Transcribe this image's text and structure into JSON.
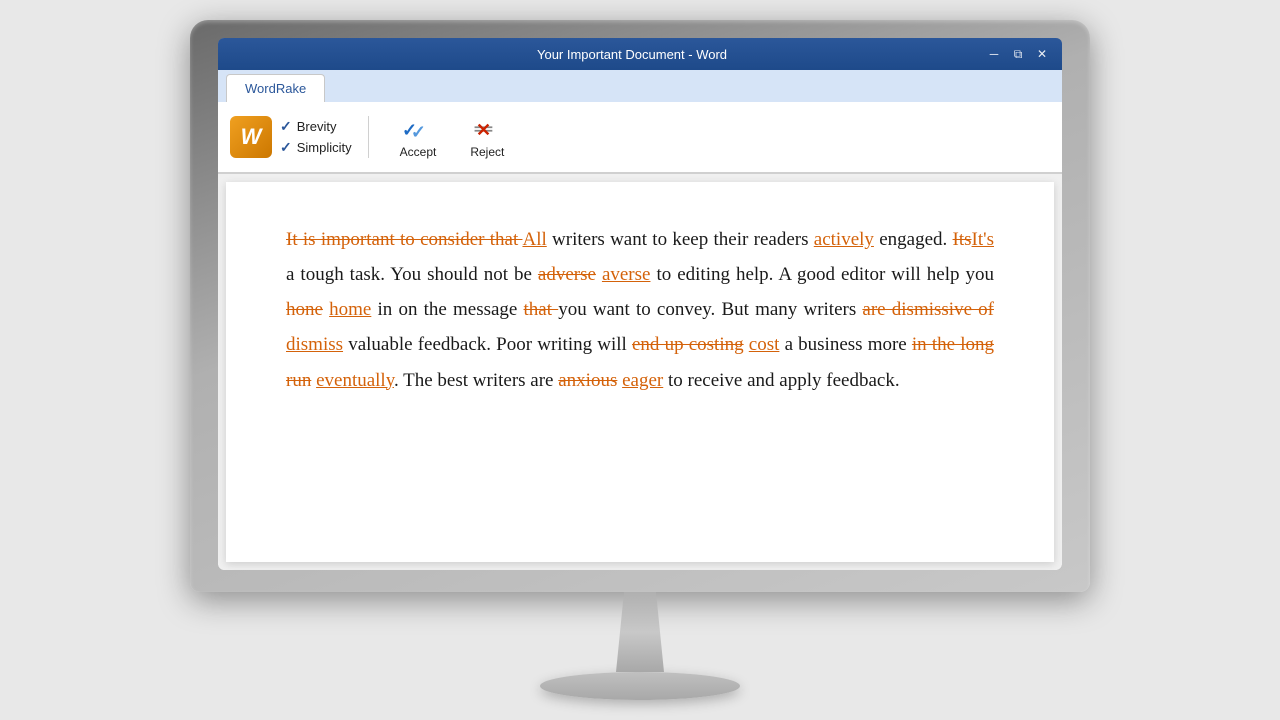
{
  "monitor": {
    "title_bar": {
      "title": "Your Important Document - Word",
      "minimize_label": "─",
      "restore_label": "⧉",
      "close_label": "✕"
    },
    "ribbon": {
      "tab_label": "WordRake",
      "logo_letter": "W",
      "checkbox1": "Brevity",
      "checkbox2": "Simplicity",
      "accept_label": "Accept",
      "reject_label": "Reject"
    },
    "document": {
      "paragraph": [
        {
          "type": "del",
          "text": "It is important to consider that "
        },
        {
          "type": "ins",
          "text": "All"
        },
        {
          "type": "normal",
          "text": " writers want to keep their readers "
        },
        {
          "type": "ins",
          "text": "actively"
        },
        {
          "type": "normal",
          "text": " engaged. "
        },
        {
          "type": "del",
          "text": "Its"
        },
        {
          "type": "ins_dash",
          "text": "It's"
        },
        {
          "type": "normal",
          "text": " a tough task. You should not be "
        },
        {
          "type": "del",
          "text": "adverse"
        },
        {
          "type": "ins",
          "text": "averse"
        },
        {
          "type": "normal",
          "text": " to editing help. A good editor will help you "
        },
        {
          "type": "del",
          "text": "hone"
        },
        {
          "type": "ins",
          "text": "home"
        },
        {
          "type": "normal",
          "text": " in on the message "
        },
        {
          "type": "del",
          "text": "that "
        },
        {
          "type": "normal",
          "text": "you want to convey. But many writers "
        },
        {
          "type": "del",
          "text": "are dismissive of"
        },
        {
          "type": "ins",
          "text": "dismiss"
        },
        {
          "type": "normal",
          "text": " valuable feedback. Poor writing will "
        },
        {
          "type": "del",
          "text": "end up costing"
        },
        {
          "type": "ins",
          "text": "cost"
        },
        {
          "type": "normal",
          "text": " a business more "
        },
        {
          "type": "del",
          "text": "in the long run"
        },
        {
          "type": "ins",
          "text": "eventually"
        },
        {
          "type": "normal",
          "text": ". The best writers are "
        },
        {
          "type": "del",
          "text": "anxious"
        },
        {
          "type": "ins",
          "text": "eager"
        },
        {
          "type": "normal",
          "text": " to receive and apply feedback."
        }
      ]
    }
  }
}
